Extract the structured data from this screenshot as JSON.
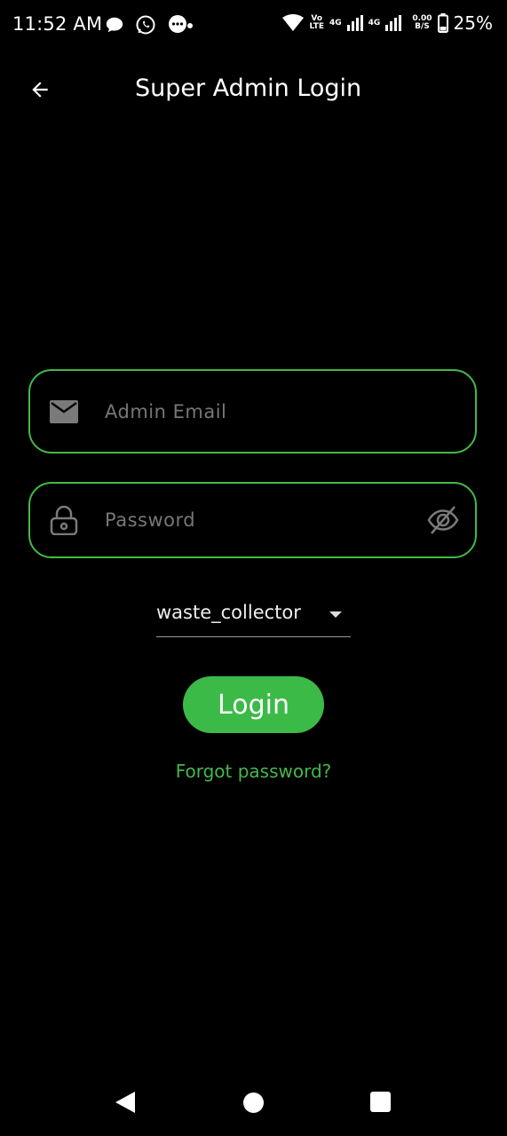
{
  "status_bar": {
    "time": "11:52 AM",
    "net_line1": "Vo",
    "net_line2": "LTE",
    "net_4g_a": "4G",
    "net_4g_b": "4G",
    "speed_value": "0.00",
    "speed_unit": "B/S",
    "battery": "25%"
  },
  "app_bar": {
    "title": "Super Admin Login"
  },
  "form": {
    "email_placeholder": "Admin Email",
    "email_value": "",
    "password_placeholder": "Password",
    "password_value": "",
    "role_selected": "waste_collector"
  },
  "actions": {
    "login_label": "Login",
    "forgot_label": "Forgot password?"
  },
  "colors": {
    "accent": "#3cba48",
    "background": "#000000",
    "placeholder": "#777777"
  },
  "icons": [
    "back-arrow-icon",
    "email-icon",
    "lock-icon",
    "visibility-off-icon",
    "dropdown-arrow-icon",
    "wifi-icon",
    "signal-icon",
    "battery-icon"
  ]
}
